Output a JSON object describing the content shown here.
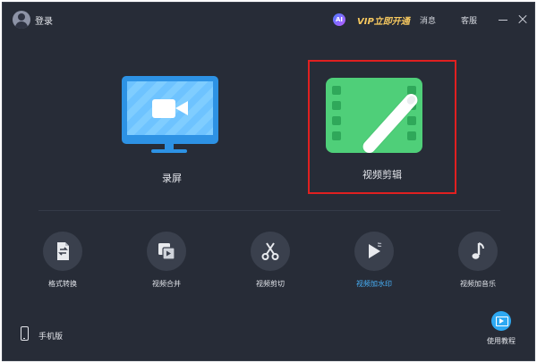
{
  "header": {
    "login_label": "登录",
    "ai_badge": "AI",
    "vip_label": "VIP立即开通",
    "messages_label": "消息",
    "service_label": "客服"
  },
  "main": {
    "record": {
      "label": "录屏",
      "icon": "monitor-camera-icon",
      "color": "#2d92e4"
    },
    "edit": {
      "label": "视频剪辑",
      "icon": "film-pen-icon",
      "color": "#4fcf79",
      "highlighted": true
    }
  },
  "tools": [
    {
      "label": "格式转换",
      "icon": "format-convert-icon"
    },
    {
      "label": "视频合并",
      "icon": "video-merge-icon"
    },
    {
      "label": "视频剪切",
      "icon": "scissors-icon"
    },
    {
      "label": "视频加水印",
      "icon": "watermark-icon",
      "active": true
    },
    {
      "label": "视频加音乐",
      "icon": "music-note-icon"
    }
  ],
  "footer": {
    "mobile_label": "手机版",
    "tutorial_label": "使用教程"
  },
  "colors": {
    "background": "#272c37",
    "accent": "#48b0f7",
    "vip": "#f6c85f",
    "highlight": "#e02020"
  }
}
